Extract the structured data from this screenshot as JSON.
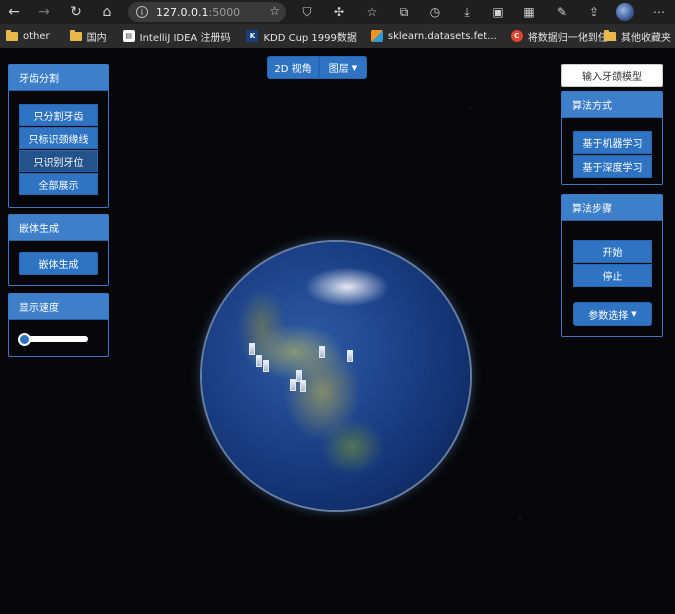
{
  "browser": {
    "address_host": "127.0.0.1",
    "address_port": ":5000",
    "bookmarks": [
      {
        "label": "other",
        "type": "folder"
      },
      {
        "label": "国内",
        "type": "folder"
      },
      {
        "label": "IntelliJ IDEA 注册码",
        "type": "site"
      },
      {
        "label": "KDD Cup 1999数据",
        "type": "site"
      },
      {
        "label": "sklearn.datasets.fet...",
        "type": "site"
      },
      {
        "label": "将数据归一化到任...",
        "type": "site"
      }
    ],
    "other_bookmarks": "其他收藏夹"
  },
  "view_toolbar": {
    "view_2d": "2D 视角",
    "layers": "图层"
  },
  "left_panels": {
    "tooth_seg": {
      "title": "牙齿分割",
      "buttons": [
        "只分割牙齿",
        "只标识颈缘线",
        "只识别牙位",
        "全部展示"
      ]
    },
    "crown_gen": {
      "title": "嵌体生成",
      "button": "嵌体生成"
    },
    "speed": {
      "title": "显示速度",
      "value": 0
    }
  },
  "right_panels": {
    "input_model": "输入牙颌模型",
    "algo_method": {
      "title": "算法方式",
      "buttons": [
        "基于机器学习",
        "基于深度学习"
      ]
    },
    "algo_steps": {
      "title": "算法步骤",
      "buttons": [
        "开始",
        "停止"
      ],
      "param_select": "参数选择"
    }
  }
}
